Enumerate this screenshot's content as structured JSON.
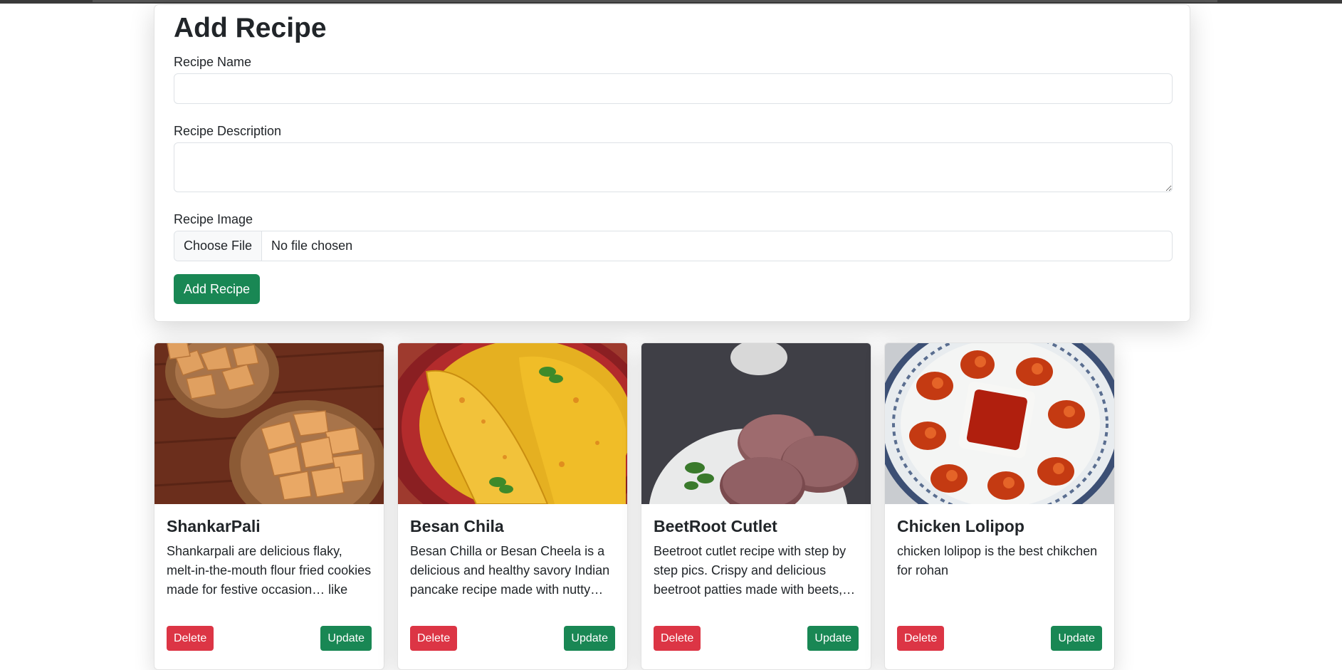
{
  "form": {
    "title": "Add Recipe",
    "name_label": "Recipe Name",
    "name_value": "",
    "description_label": "Recipe Description",
    "description_value": "",
    "image_label": "Recipe Image",
    "file_button": "Choose File",
    "file_status": "No file chosen",
    "submit_label": "Add Recipe"
  },
  "recipes": [
    {
      "title": "ShankarPali",
      "description": "Shankarpali are delicious flaky, melt-in-the-mouth flour fried cookies made for festive occasion… like Diwali. Make these sweet",
      "delete_label": "Delete",
      "update_label": "Update",
      "image": "shankarpali-photo"
    },
    {
      "title": "Besan Chila",
      "description": "Besan Chilla or Besan Cheela is a delicious and healthy savory Indian pancake recipe made with nutty… gram flour (besan) and spices",
      "delete_label": "Delete",
      "update_label": "Update",
      "image": "besan-chila-photo"
    },
    {
      "title": "BeetRoot Cutlet",
      "description": "Beetroot cutlet recipe with step by step pics. Crispy and delicious beetroot patties made with beets,… potatoes, spices and veggies. An",
      "delete_label": "Delete",
      "update_label": "Update",
      "image": "beetroot-cutlet-photo"
    },
    {
      "title": "Chicken Lolipop",
      "description": "chicken lolipop is the best chikchen for rohan",
      "delete_label": "Delete",
      "update_label": "Update",
      "image": "chicken-lolipop-photo"
    }
  ],
  "colors": {
    "success": "#198754",
    "danger": "#dc3545"
  }
}
